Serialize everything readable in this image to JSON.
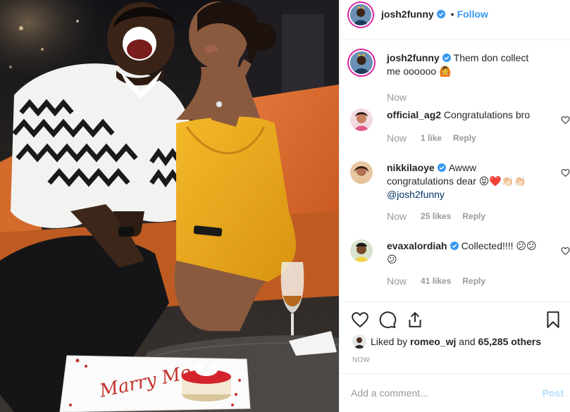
{
  "photo": {
    "plate_text": "Marry Me.."
  },
  "header": {
    "username": "josh2funny",
    "separator": "•",
    "follow_label": "Follow",
    "verified_icon": "verified-badge-icon"
  },
  "comments": [
    {
      "username": "josh2funny",
      "verified": true,
      "text": "Them don collect me oooooo 🙆",
      "time": "Now",
      "likes": "",
      "reply": ""
    },
    {
      "username": "official_ag2",
      "verified": false,
      "text": "Congratulations bro",
      "time": "Now",
      "likes": "1 like",
      "reply": "Reply"
    },
    {
      "username": "nikkilaoye",
      "verified": true,
      "text_part1": "Awww congratulations dear 😝❤️👏🏻👏🏻",
      "mention": "@josh2funny",
      "time": "Now",
      "likes": "25 likes",
      "reply": "Reply"
    },
    {
      "username": "evaxalordiah",
      "verified": true,
      "text": "Collected!!!! 😕😕😕",
      "time": "Now",
      "likes": "41 likes",
      "reply": "Reply"
    }
  ],
  "likes_summary": {
    "prefix": "Liked by",
    "liker": "romeo_wj",
    "conjunction": "and",
    "others": "65,285 others"
  },
  "posted_time": "NOW",
  "composer": {
    "placeholder": "Add a comment...",
    "post_label": "Post"
  },
  "colors": {
    "accent": "#3897f0",
    "post_disabled": "#b2dffc",
    "muted": "#999999",
    "border": "#efefef"
  }
}
